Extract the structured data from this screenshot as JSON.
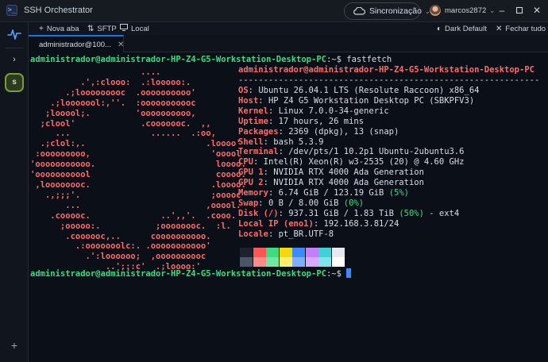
{
  "window": {
    "title": "SSH Orchestrator",
    "sync_label": "Sincronização",
    "user_name": "marcos2872"
  },
  "toolbar": {
    "new_tab": "Nova aba",
    "sftp": "SFTP",
    "local": "Local",
    "theme": "Dark Default",
    "close_all": "Fechar tudo"
  },
  "rail": {
    "session_initial": "s"
  },
  "tab": {
    "label": "administrador@100..."
  },
  "terminal": {
    "prompt_user": "administrador@administrador-HP-Z4-G5-Workstation-Desktop-PC",
    "prompt_sep": ":~$",
    "command": "fastfetch",
    "header": "administrador@administrador-HP-Z4-G5-Workstation-Desktop-PC",
    "divider": "------------------------------------------------------------",
    "logo": [
      "                      ....",
      "          .',:clooo:  .:looooo:.",
      "       .;looooooooc  .oooooooooo'",
      "    .;looooool:,''.  :ooooooooooc",
      "   ;looool;.         'oooooooooo,",
      "  ;clool'             .cooooooc.  ,,",
      "     ...                ......  .:oo,",
      "  .;clol:,.                        .loooo'",
      " :ooooooooo,                        'ooool",
      "'ooooooooooo.                        loooo.",
      "'ooooooooool                         coooo.",
      " ,loooooooc.                        .loooo.",
      "   .,;;;'.                          ;ooooc",
      "       ...                         ,ooool.",
      "    .cooooc.              ..',,'.  .cooo.",
      "      ;ooooo:.           ;oooooooc.  :l.",
      "       .coooooc,..      coooooooooo.",
      "         .:ooooooolc:. .ooooooooooo'",
      "           .':loooooo;  ,oooooooooc",
      "               ..';::c'  .;loooo:'"
    ],
    "info": [
      {
        "key": "OS",
        "value": "Ubuntu 26.04.1 LTS (Resolute Raccoon) x86_64"
      },
      {
        "key": "Host",
        "value": "HP Z4 G5 Workstation Desktop PC (SBKPFV3)"
      },
      {
        "key": "Kernel",
        "value": "Linux 7.0.0-34-generic"
      },
      {
        "key": "Uptime",
        "value": "17 hours, 26 mins"
      },
      {
        "key": "Packages",
        "value": "2369 (dpkg), 13 (snap)"
      },
      {
        "key": "Shell",
        "value": "bash 5.3.9"
      },
      {
        "key": "Terminal",
        "value": "/dev/pts/1 10.2p1 Ubuntu-2ubuntu3.6"
      },
      {
        "key": "CPU",
        "value": "Intel(R) Xeon(R) w3-2535 (20) @ 4.60 GHz"
      },
      {
        "key": "GPU 1",
        "value": "NVIDIA RTX 4000 Ada Generation"
      },
      {
        "key": "GPU 2",
        "value": "NVIDIA RTX 4000 Ada Generation"
      },
      {
        "key": "Memory",
        "value": "6.74 GiB / 123.19 GiB",
        "pct": "(5%)"
      },
      {
        "key": "Swap",
        "value": "0 B / 8.00 GiB",
        "pct": "(0%)"
      },
      {
        "key": "Disk (/)",
        "value": "937.31 GiB / 1.83 TiB",
        "pct": "(50%)",
        "tail": " - ext4"
      },
      {
        "key": "Local IP (eno1)",
        "value": "192.168.3.81/24"
      },
      {
        "key": "Locale",
        "value": "pt_BR.UTF-8"
      }
    ],
    "palette_top": [
      "#1e2230",
      "#ff5555",
      "#3ddc84",
      "#f5d90a",
      "#3b8bff",
      "#c77dff",
      "#3fd1d6",
      "#e6e9ef"
    ],
    "palette_bottom": [
      "#4c5566",
      "#ff8a8a",
      "#6ee7a0",
      "#fff06a",
      "#7ab0ff",
      "#dba8ff",
      "#7ee6ea",
      "#ffffff"
    ]
  }
}
